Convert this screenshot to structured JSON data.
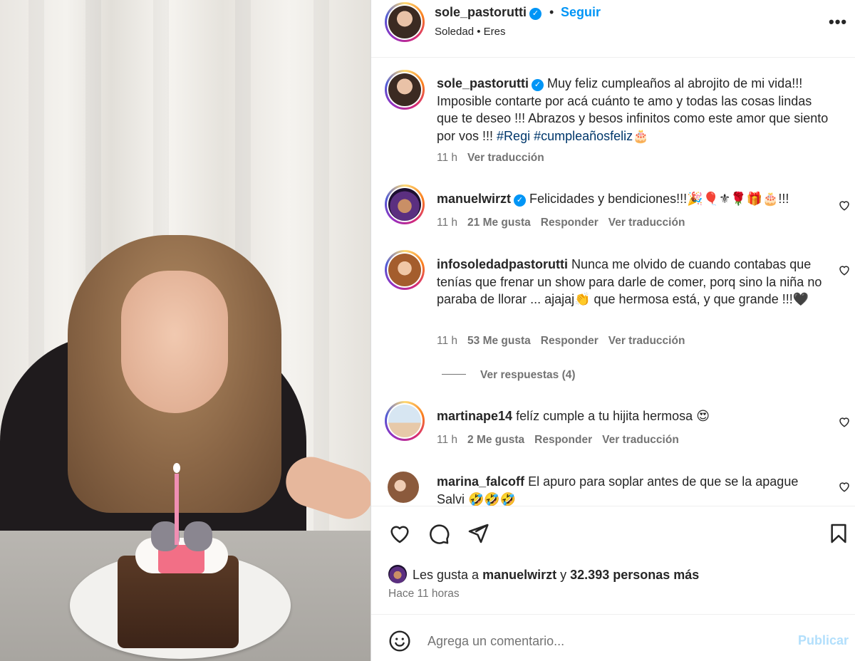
{
  "header": {
    "username": "sole_pastorutti",
    "dot": "•",
    "follow_label": "Seguir",
    "subtitle": "Soledad • Eres",
    "more_icon": "more-horizontal-icon"
  },
  "caption": {
    "username": "sole_pastorutti",
    "text": "Muy feliz cumpleaños al abrojito de mi vida!!! Imposible contarte por acá cuánto te amo y todas las cosas lindas que te deseo !!! Abrazos y besos infinitos como este amor que siento por vos !!! ",
    "hashtags": "#Regi #cumpleañosfeliz🎂",
    "time": "11 h",
    "translate": "Ver traducción"
  },
  "comments": [
    {
      "username": "manuelwirzt",
      "verified": true,
      "text": "Felicidades y bendiciones!!!🎉🎈⚜🌹🎁🎂!!!",
      "time": "11 h",
      "likes": "21 Me gusta",
      "reply": "Responder",
      "translate": "Ver traducción"
    },
    {
      "username": "infosoledadpastorutti",
      "text": "Nunca me olvido de cuando contabas que tenías que frenar un show para darle de comer, porq sino la niña no paraba de llorar ... ajajaj👏 que hermosa está, y que grande !!!🖤",
      "time": "11 h",
      "likes": "53 Me gusta",
      "reply": "Responder",
      "translate": "Ver traducción",
      "view_replies": "Ver respuestas (4)"
    },
    {
      "username": "martinape14",
      "text": "felíz cumple a tu hijita hermosa 😍",
      "time": "11 h",
      "likes": "2 Me gusta",
      "reply": "Responder",
      "translate": "Ver traducción"
    },
    {
      "username": "marina_falcoff",
      "text": "El apuro para soplar antes de que se la apague Salvi 🤣🤣🤣"
    }
  ],
  "actions": {
    "like_icon": "heart-icon",
    "comment_icon": "comment-icon",
    "share_icon": "send-icon",
    "save_icon": "bookmark-icon"
  },
  "likes": {
    "prefix": "Les gusta a",
    "user": "manuelwirzt",
    "joiner": "y",
    "others": "32.393 personas más"
  },
  "posted": "Hace 11 horas",
  "composer": {
    "emoji_icon": "emoji-icon",
    "placeholder": "Agrega un comentario...",
    "publish_label": "Publicar"
  },
  "colors": {
    "link_blue": "#0095f6",
    "hashtag": "#00376b",
    "muted": "#737373",
    "publish_disabled": "#b2dffc"
  }
}
